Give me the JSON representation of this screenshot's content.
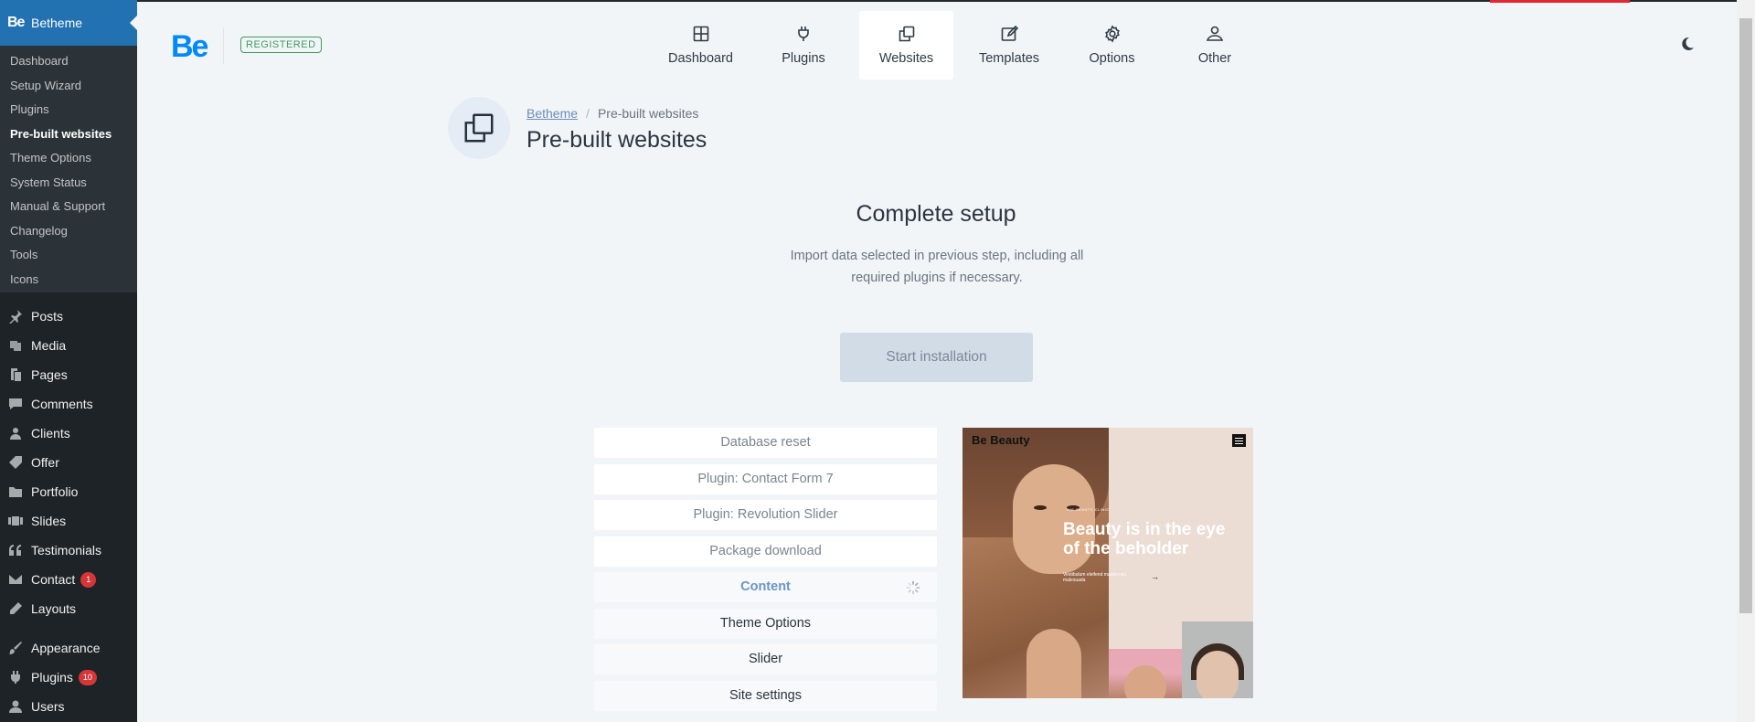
{
  "sidebar": {
    "header": {
      "logo": "Be",
      "label": "Betheme"
    },
    "submenu": [
      {
        "label": "Dashboard",
        "current": false
      },
      {
        "label": "Setup Wizard",
        "current": false
      },
      {
        "label": "Plugins",
        "current": false
      },
      {
        "label": "Pre-built websites",
        "current": true
      },
      {
        "label": "Theme Options",
        "current": false
      },
      {
        "label": "System Status",
        "current": false
      },
      {
        "label": "Manual & Support",
        "current": false
      },
      {
        "label": "Changelog",
        "current": false
      },
      {
        "label": "Tools",
        "current": false
      },
      {
        "label": "Icons",
        "current": false
      }
    ],
    "menu": [
      {
        "label": "Posts",
        "icon": "pin-icon"
      },
      {
        "label": "Media",
        "icon": "media-icon"
      },
      {
        "label": "Pages",
        "icon": "pages-icon"
      },
      {
        "label": "Comments",
        "icon": "comments-icon"
      },
      {
        "label": "Clients",
        "icon": "clients-icon"
      },
      {
        "label": "Offer",
        "icon": "offer-icon"
      },
      {
        "label": "Portfolio",
        "icon": "portfolio-icon"
      },
      {
        "label": "Slides",
        "icon": "slides-icon"
      },
      {
        "label": "Testimonials",
        "icon": "quote-icon"
      },
      {
        "label": "Contact",
        "icon": "mail-icon",
        "badge": "1"
      },
      {
        "label": "Layouts",
        "icon": "pencil-icon"
      },
      {
        "label": "Appearance",
        "icon": "brush-icon"
      },
      {
        "label": "Plugins",
        "icon": "plugin-icon",
        "badge": "10"
      },
      {
        "label": "Users",
        "icon": "user-icon"
      }
    ]
  },
  "header": {
    "logo": "Be",
    "status_badge": "REGISTERED",
    "tabs": [
      {
        "label": "Dashboard",
        "icon": "dashboard-icon",
        "active": false
      },
      {
        "label": "Plugins",
        "icon": "plug-icon",
        "active": false
      },
      {
        "label": "Websites",
        "icon": "websites-icon",
        "active": true
      },
      {
        "label": "Templates",
        "icon": "templates-icon",
        "active": false
      },
      {
        "label": "Options",
        "icon": "gear-icon",
        "active": false
      },
      {
        "label": "Other",
        "icon": "other-icon",
        "active": false
      }
    ],
    "theme_toggle_icon": "moon-icon"
  },
  "page": {
    "breadcrumb": {
      "root": "Betheme",
      "separator": "/",
      "current": "Pre-built websites"
    },
    "title": "Pre-built websites"
  },
  "setup": {
    "title": "Complete setup",
    "description": "Import data selected in previous step, including all required plugins if necessary.",
    "start_button": "Start installation"
  },
  "steps": [
    {
      "label": "Database reset",
      "state": "done"
    },
    {
      "label": "Plugin: Contact Form 7",
      "state": "done"
    },
    {
      "label": "Plugin: Revolution Slider",
      "state": "done"
    },
    {
      "label": "Package download",
      "state": "done"
    },
    {
      "label": "Content",
      "state": "active"
    },
    {
      "label": "Theme Options",
      "state": "pending"
    },
    {
      "label": "Slider",
      "state": "pending"
    },
    {
      "label": "Site settings",
      "state": "pending"
    }
  ],
  "preview": {
    "brand": "Be Beauty",
    "kicker": "THE BEAUTY CLINIC",
    "headline": "Beauty is in the eye of the beholder",
    "subtext": "Vestibulum eleifend mauris nec malesuada",
    "arrow": "→"
  },
  "colors": {
    "accent": "#0089f7",
    "wp_blue": "#2271b1",
    "registered_green": "#3e9c60",
    "badge_red": "#d63638"
  }
}
